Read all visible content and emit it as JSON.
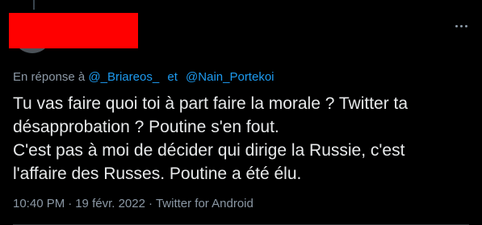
{
  "tweet": {
    "reply_prefix": "En réponse à",
    "reply_mention_1": "@_Briareos_",
    "reply_and": "et",
    "reply_mention_2": "@Nain_Portekoi",
    "text_lines": [
      "Tu vas faire quoi toi à part faire la morale ? Twitter ta",
      "désapprobation ? Poutine s'en fout.",
      "C'est pas à moi de décider qui dirige la Russie, c'est",
      "l'affaire des Russes. Poutine a été élu."
    ],
    "time": "10:40 PM",
    "date": "19 févr. 2022",
    "dot": "·",
    "source": "Twitter for Android",
    "more_icon": "more-horizontal-icon"
  },
  "colors": {
    "background": "#000000",
    "text": "#e7e9ea",
    "secondary": "#8b98a5",
    "link": "#1d9bf0",
    "redaction": "#ff0000"
  }
}
